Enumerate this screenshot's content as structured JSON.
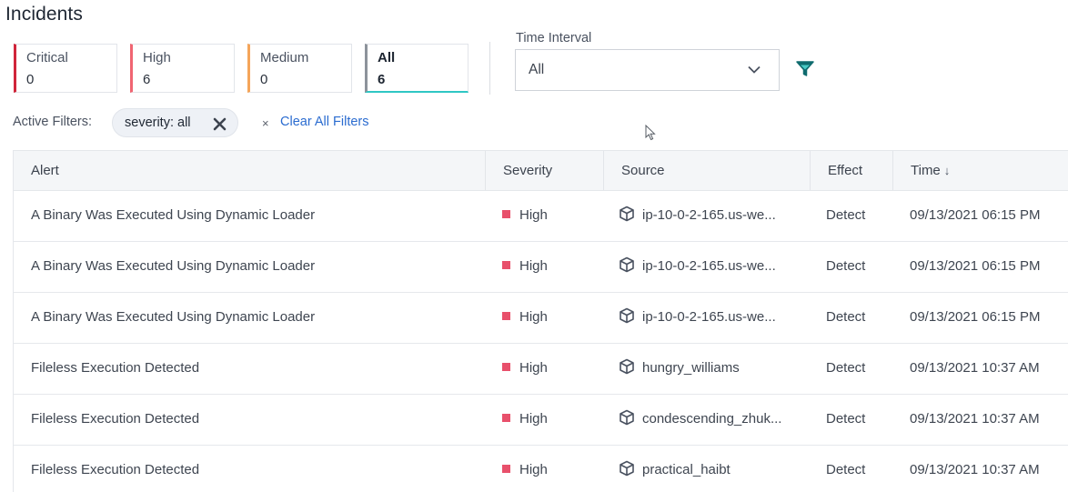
{
  "header": {
    "title": "Incidents"
  },
  "severity_cards": [
    {
      "label": "Critical",
      "count": "0",
      "color": "#d0253a"
    },
    {
      "label": "High",
      "count": "6",
      "color": "#f06572"
    },
    {
      "label": "Medium",
      "count": "0",
      "color": "#f5a55a"
    },
    {
      "label": "All",
      "count": "6",
      "color": "#8d939b",
      "active": true
    }
  ],
  "time_interval": {
    "label": "Time Interval",
    "value": "All"
  },
  "filters": {
    "label": "Active Filters:",
    "chip": "severity: all",
    "clear_icon": "×",
    "clear_label": "Clear All Filters"
  },
  "table": {
    "columns": [
      "Alert",
      "Severity",
      "Source",
      "Effect",
      "Time"
    ],
    "sort_indicator": "↓",
    "rows": [
      {
        "alert": "A Binary Was Executed Using Dynamic Loader",
        "severity": "High",
        "source": "ip-10-0-2-165.us-we...",
        "effect": "Detect",
        "time": "09/13/2021 06:15 PM"
      },
      {
        "alert": "A Binary Was Executed Using Dynamic Loader",
        "severity": "High",
        "source": "ip-10-0-2-165.us-we...",
        "effect": "Detect",
        "time": "09/13/2021 06:15 PM"
      },
      {
        "alert": "A Binary Was Executed Using Dynamic Loader",
        "severity": "High",
        "source": "ip-10-0-2-165.us-we...",
        "effect": "Detect",
        "time": "09/13/2021 06:15 PM"
      },
      {
        "alert": "Fileless Execution Detected",
        "severity": "High",
        "source": "hungry_williams",
        "effect": "Detect",
        "time": "09/13/2021 10:37 AM"
      },
      {
        "alert": "Fileless Execution Detected",
        "severity": "High",
        "source": "condescending_zhuk...",
        "effect": "Detect",
        "time": "09/13/2021 10:37 AM"
      },
      {
        "alert": "Fileless Execution Detected",
        "severity": "High",
        "source": "practical_haibt",
        "effect": "Detect",
        "time": "09/13/2021 10:37 AM"
      }
    ]
  },
  "theme": {
    "accent": "#2fc7c4",
    "link": "#2b6cd0",
    "severity_high": "#e8506b",
    "filter_icon": "#0f6b6e"
  },
  "icons": {
    "chevron": "chevron-down-icon",
    "filter": "filter-funnel-icon",
    "chip_remove": "close-icon",
    "source": "container-cube-icon"
  }
}
